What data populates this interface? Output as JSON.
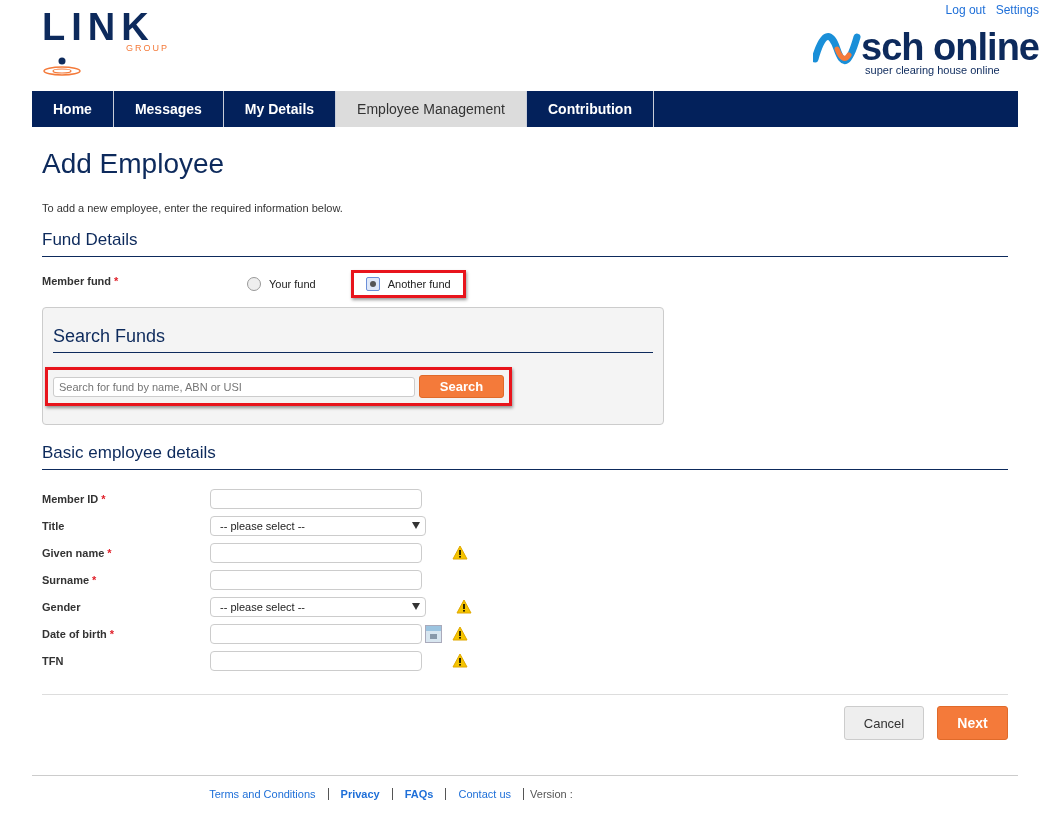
{
  "header": {
    "links": [
      "Log out",
      "Settings"
    ],
    "logo_left": {
      "word": "LINK",
      "sub": "GROUP"
    },
    "logo_right": {
      "word": "sch online",
      "tagline": "super clearing house online"
    }
  },
  "nav": [
    {
      "label": "Home",
      "selected": false
    },
    {
      "label": "Messages",
      "selected": false
    },
    {
      "label": "My Details",
      "selected": false
    },
    {
      "label": "Employee Management",
      "selected": true
    },
    {
      "label": "Contribution",
      "selected": false
    }
  ],
  "page_title": "Add Employee",
  "intro": "To add a new employee, enter the required information below.",
  "required_mark": "*",
  "fund_details": {
    "heading": "Fund Details",
    "label": "Member fund",
    "required": true,
    "options": [
      {
        "label": "Your fund",
        "selected": false,
        "highlighted": false
      },
      {
        "label": "Another fund",
        "selected": true,
        "highlighted": true
      }
    ],
    "search": {
      "heading": "Search Funds",
      "placeholder": "Search for fund by name, ABN or USI",
      "button": "Search",
      "highlighted": true
    }
  },
  "basic": {
    "heading": "Basic employee details",
    "fields": [
      {
        "label": "Member ID",
        "required": true,
        "kind": "text",
        "warning": false
      },
      {
        "label": "Title",
        "required": false,
        "kind": "select",
        "value": "-- please select --",
        "warning": false
      },
      {
        "label": "Given name",
        "required": true,
        "kind": "text",
        "warning": true
      },
      {
        "label": "Surname",
        "required": true,
        "kind": "text",
        "warning": false
      },
      {
        "label": "Gender",
        "required": false,
        "kind": "select",
        "value": "-- please select --",
        "warning": true
      },
      {
        "label": "Date of birth",
        "required": true,
        "kind": "date",
        "warning": true
      },
      {
        "label": "TFN",
        "required": false,
        "kind": "text",
        "warning": true
      }
    ]
  },
  "buttons": [
    {
      "label": "Cancel",
      "kind": "secondary"
    },
    {
      "label": "Next",
      "kind": "primary"
    }
  ],
  "footer": {
    "links": [
      "Terms and Conditions",
      "Privacy",
      "FAQs",
      "Contact us"
    ],
    "version_label": "Version :"
  }
}
